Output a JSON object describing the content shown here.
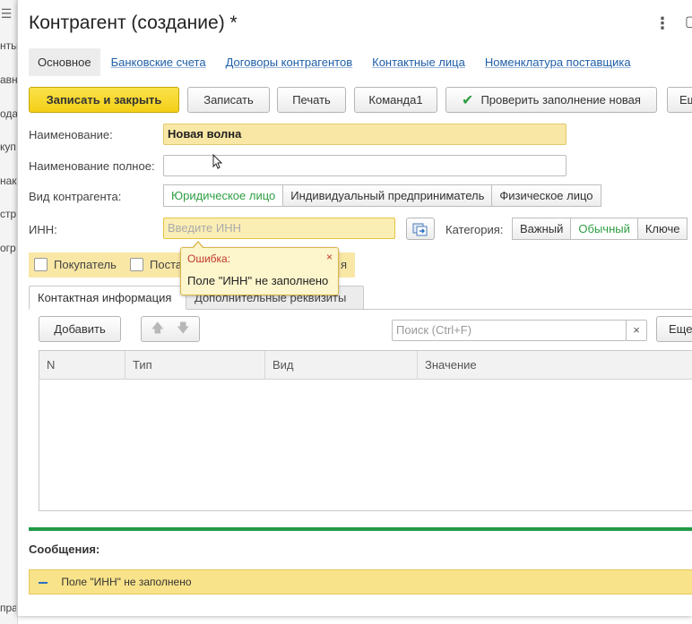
{
  "background": {
    "fragments": [
      "нты",
      "авн",
      "ода",
      "куп",
      "нак",
      "стр",
      "огр"
    ],
    "bottom_fragment": "пра"
  },
  "window": {
    "title": "Контрагент (создание) *",
    "kebab_icon": "⋮",
    "window_icon": "▢"
  },
  "tabs": [
    "Основное",
    "Банковские счета",
    "Договоры контрагентов",
    "Контактные лица",
    "Номенклатура поставщика"
  ],
  "toolbar": {
    "save_close": "Записать и закрыть",
    "save": "Записать",
    "print": "Печать",
    "command1": "Команда1",
    "check": "Проверить заполнение новая",
    "more": "Ещ"
  },
  "fields": {
    "name_label": "Наименование:",
    "name_value": "Новая волна",
    "fullname_label": "Наименование полное:",
    "fullname_value": "",
    "kind_label": "Вид контрагента:",
    "kind_options": [
      "Юридическое лицо",
      "Индивидуальный предприниматель",
      "Физическое лицо"
    ],
    "kind_selected": "Юридическое лицо",
    "inn_label": "ИНН:",
    "inn_placeholder": "Введите ИНН",
    "category_label": "Категория:",
    "category_options": [
      "Важный",
      "Обычный",
      "Ключе"
    ],
    "category_selected": "Обычный",
    "checkbox_buyer": "Покупатель",
    "checkbox_supplier": "Поста",
    "checkbox_hidden_tail": "я"
  },
  "tooltip": {
    "title": "Ошибка:",
    "text": "Поле \"ИНН\" не заполнено",
    "close_glyph": "×"
  },
  "subtabs": [
    "Контактная информация",
    "Дополнительные реквизиты"
  ],
  "contact_toolbar": {
    "add": "Добавить",
    "search_placeholder": "Поиск (Ctrl+F)",
    "clear_glyph": "×",
    "more": "Еще"
  },
  "table": {
    "columns": [
      "N",
      "Тип",
      "Вид",
      "Значение"
    ]
  },
  "messages": {
    "label": "Сообщения:",
    "items": [
      "Поле \"ИНН\" не заполнено"
    ]
  },
  "colors": {
    "accent_yellow": "#f3cf17",
    "error_red": "#c0392b",
    "link_blue": "#1f5fa8",
    "selected_green": "#2e9e43",
    "separator_green": "#1f9b45"
  }
}
